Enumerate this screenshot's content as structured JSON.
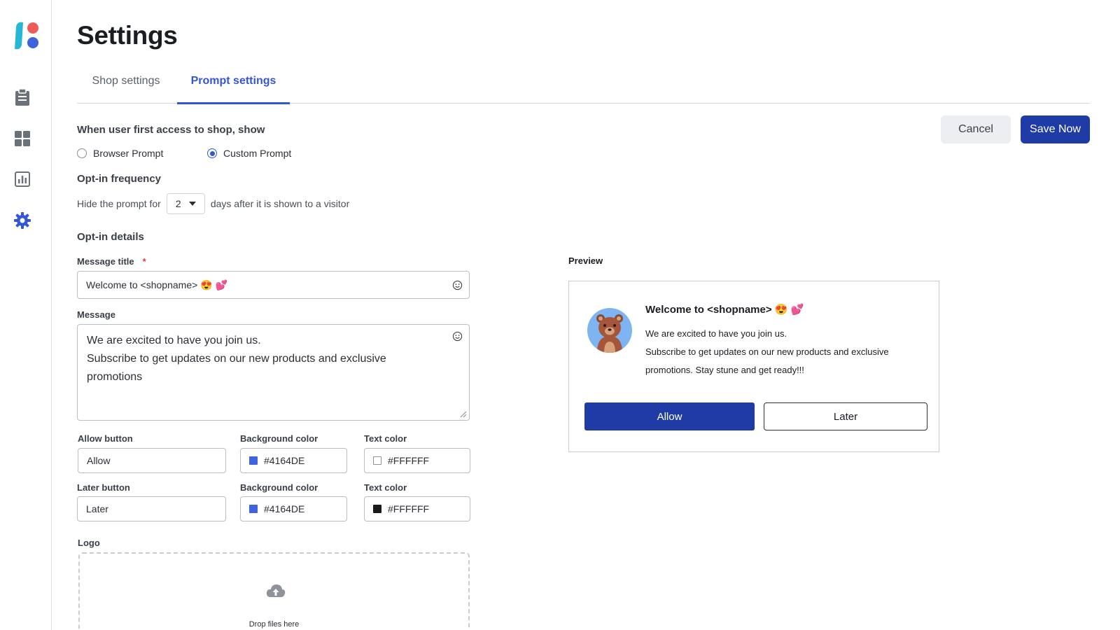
{
  "page": {
    "title": "Settings"
  },
  "sidebar": {
    "items": [
      {
        "name": "logo",
        "icon": "brand-logo"
      },
      {
        "name": "orders",
        "icon": "clipboard-icon"
      },
      {
        "name": "dashboard",
        "icon": "grid-icon"
      },
      {
        "name": "reports",
        "icon": "bar-chart-icon"
      },
      {
        "name": "settings",
        "icon": "gear-icon",
        "active": true
      }
    ]
  },
  "tabs": [
    {
      "label": "Shop settings",
      "active": false
    },
    {
      "label": "Prompt settings",
      "active": true
    }
  ],
  "actions": {
    "cancel_label": "Cancel",
    "save_label": "Save Now"
  },
  "first_access": {
    "heading": "When user first access to shop, show",
    "options": [
      {
        "label": "Browser Prompt",
        "checked": false
      },
      {
        "label": "Custom Prompt",
        "checked": true
      }
    ]
  },
  "frequency": {
    "heading": "Opt-in frequency",
    "prefix": "Hide the prompt for",
    "value": "2",
    "suffix": "days after it is shown to a visitor"
  },
  "details": {
    "heading": "Opt-in details",
    "title_label": "Message title",
    "required_mark": "*",
    "title_value": "Welcome to <shopname> 😍 💕",
    "message_label": "Message",
    "message_line1": "We are excited to have you join us.",
    "message_line2": "Subscribe to get updates on our new products and exclusive promotions",
    "allow_button_label": "Allow button",
    "allow_button_value": "Allow",
    "bg_color_label": "Background color",
    "text_color_label": "Text color",
    "allow_bg_value": "#4164DE",
    "allow_text_value": "#FFFFFF",
    "later_button_label": "Later button",
    "later_button_value": "Later",
    "later_bg_value": "#4164DE",
    "later_text_value": "#FFFFFF",
    "logo_label": "Logo",
    "drop_label": "Drop files here"
  },
  "preview": {
    "label": "Preview",
    "title": "Welcome to <shopname> 😍 💕",
    "line1": "We are excited to have you join us.",
    "line2": "Subscribe to get updates on our new products and exclusive promotions. Stay stune and get ready!!!",
    "allow_label": "Allow",
    "later_label": "Later"
  },
  "colors": {
    "accent": "#3356d6",
    "primary_button": "#1f3ca6",
    "swatch_blue": "#4164DE",
    "swatch_white": "#FFFFFF",
    "swatch_black": "#1a1a1a"
  }
}
